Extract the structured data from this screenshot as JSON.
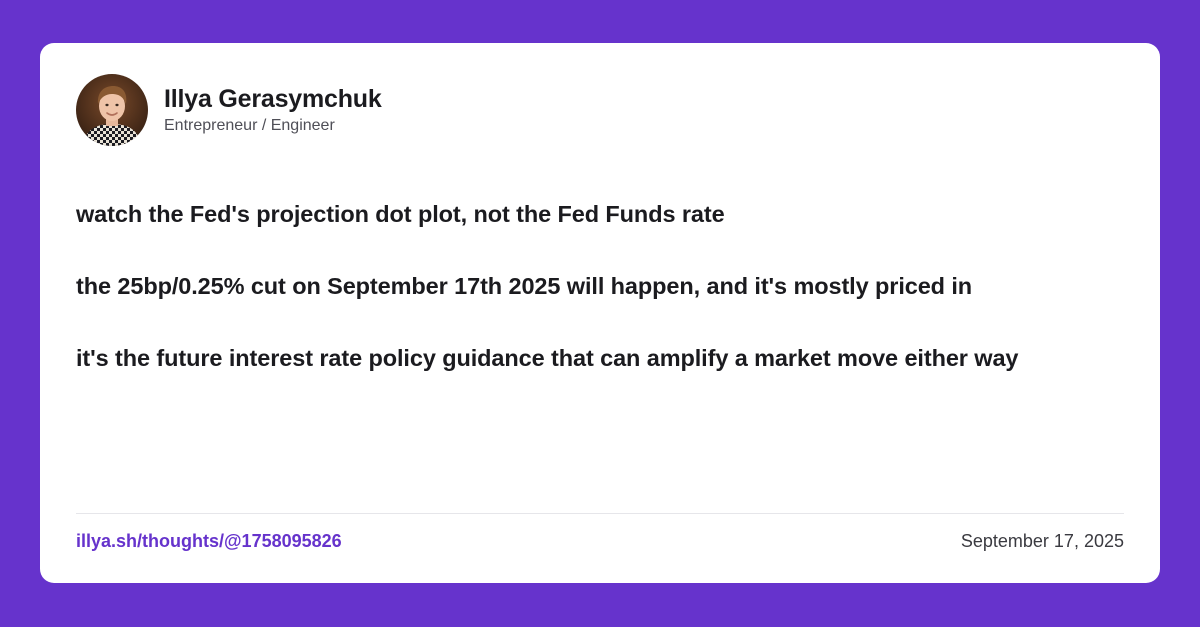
{
  "colors": {
    "background": "#6633cc",
    "card": "#ffffff",
    "text": "#1b1b1f",
    "muted": "#4f4f57",
    "link": "#6633cc",
    "divider": "#e6e6ea"
  },
  "author": {
    "name": "Illya Gerasymchuk",
    "title": "Entrepreneur / Engineer",
    "avatar_icon": "profile-photo"
  },
  "post": {
    "paragraphs": [
      "watch the Fed's projection dot plot, not the Fed Funds rate",
      "the 25bp/0.25% cut on September 17th 2025 will happen, and it's mostly priced in",
      "it's the future interest rate policy guidance that can amplify a market move either way"
    ]
  },
  "footer": {
    "link_text": "illya.sh/thoughts/@1758095826",
    "date": "September 17, 2025"
  }
}
